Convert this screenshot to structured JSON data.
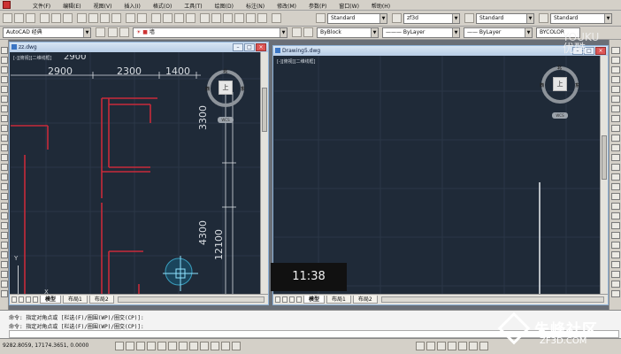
{
  "app": {
    "menus": [
      "文件(F)",
      "编辑(E)",
      "视图(V)",
      "插入(I)",
      "格式(O)",
      "工具(T)",
      "绘图(D)",
      "标注(N)",
      "修改(M)",
      "参数(P)",
      "窗口(W)",
      "帮助(H)"
    ]
  },
  "toolbar": {
    "text_style": "Standard",
    "dim_style": "zf3d",
    "table_style": "Standard",
    "multileader_style": "Standard",
    "workspace": "AutoCAD 经典",
    "layer": "墙",
    "color": "ByBlock",
    "linetype": "ByLayer",
    "lineweight": "ByLayer",
    "plot_style": "BYCOLOR"
  },
  "left_doc": {
    "title": "zz.dwg",
    "viewport_label": "[-][俯视][二维线框]",
    "dimensions": [
      "2900",
      "2300",
      "1400",
      "3300",
      "4300",
      "12100"
    ],
    "dim_partial": "2900",
    "viewcube": {
      "top": "北",
      "left": "西",
      "right": "东",
      "face": "上",
      "wcs": "WCS"
    },
    "ucs": {
      "x": "X",
      "y": "Y"
    },
    "tabs": [
      "模型",
      "布局1",
      "布局2"
    ]
  },
  "right_doc": {
    "title": "Drawing5.dwg",
    "viewport_label": "[-][俯视][二维线框]",
    "viewcube": {
      "top": "北",
      "left": "西",
      "right": "东",
      "face": "上",
      "wcs": "WCS"
    },
    "tabs": [
      "模型",
      "布局1",
      "布局2"
    ]
  },
  "command": {
    "line1": "命令: 指定对角点或 [栏选(F)/圈围(WP)/圈交(CP)]:",
    "line2": "命令: 指定对角点或 [栏选(F)/圈围(WP)/圈交(CP)]:"
  },
  "status": {
    "coords": "9282.8059, 17174.3651, 0.0000"
  },
  "overlay": {
    "timestamp": "11:38",
    "watermark_top_1": "YOUKU",
    "watermark_top_2": "优酷",
    "watermark_br_1": "朱峰社区",
    "watermark_br_2": "ZF3D.COM"
  },
  "colors": {
    "canvas": "#1f2a38",
    "wall_red": "#c82a3a",
    "dim_white": "#d9dde2"
  }
}
